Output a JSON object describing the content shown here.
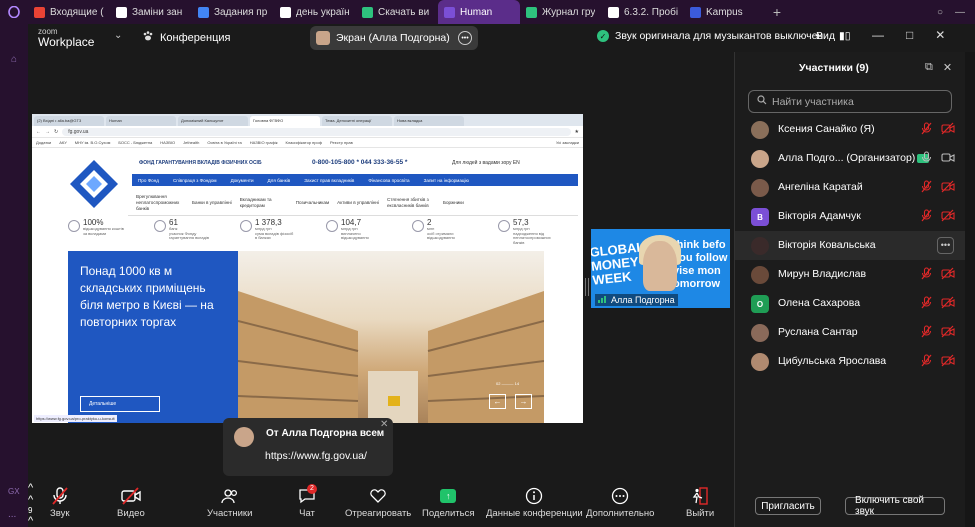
{
  "tabstrip": {
    "tabs": [
      {
        "label": "Входящие (",
        "color": "#ea4335"
      },
      {
        "label": "Заміни зан",
        "color": "#ffffff"
      },
      {
        "label": "Задания пр",
        "color": "#4285f4"
      },
      {
        "label": "день україн",
        "color": "#ffffff"
      },
      {
        "label": "Скачать ви",
        "color": "#2ec27e"
      },
      {
        "label": "Human",
        "color": "#7b4fd6",
        "active": true
      },
      {
        "label": "Журнал гру",
        "color": "#2ec27e"
      },
      {
        "label": "6.3.2. Пробі",
        "color": "#ffffff"
      },
      {
        "label": "Kampus",
        "color": "#3b5bdb"
      }
    ]
  },
  "os_sidebar": {
    "bottom_label": "GX",
    "dots": "..."
  },
  "zoom": {
    "logo_top": "zoom",
    "logo_bottom": "Workplace",
    "meeting_label": "Конференция",
    "screen_pill": "Экран (Алла Подгорна)",
    "audio_note": "Звук оригинала для музыкантов выключен",
    "view_label": "Вид"
  },
  "shared_screen": {
    "browser_tabs": [
      "(2) Вхідні • alla.ba@GT3",
      "Human",
      "Допоміжний Калькулят",
      "Головна ФГВФО",
      "Тема. Депозитні операції",
      "Нова вкладка"
    ],
    "url": "fg.gov.ua",
    "bookmarks": [
      "Додатки",
      "АКУ",
      "МНУ ім. В.О.Сухом",
      "БОСС - Бюджетна",
      "НАЗВІО",
      "Jethealth",
      "Освіта в Україні та",
      "НАЗВІО графік",
      "Класифікатор проф",
      "Реєстр прав"
    ],
    "bookmarks_right": "Усі закладки",
    "site_title": "ФОНД ГАРАНТУВАННЯ ВКЛАДІВ ФІЗИЧНИХ ОСІБ",
    "phones": "0-800-105-800 *   044 333-36-55 *",
    "accessibility": "Для людей з вадами зору   EN",
    "nav": [
      "Про Фонд",
      "Співпраця з Фондом",
      "Документи",
      "Для банків",
      "Захист прав вкладників",
      "Фінансова просвіта",
      "Запит на інформацію"
    ],
    "menu": [
      "Врегулювання неплатоспроможних банків",
      "Банки в управлінні",
      "Вкладникам та кредиторам",
      "Позичальникам",
      "Активи в управлінні",
      "Стягнення збитків з ексвласників банків",
      "Боржники"
    ],
    "stats": [
      {
        "value": "100%",
        "label": "відшкодування коштів\nза вкладами"
      },
      {
        "value": "61",
        "label": "банк\nучасник Фонду\nгарантування вкладів"
      },
      {
        "value": "1 378,3",
        "label": "млрд грн\nсума вкладів фізосіб\nв банках"
      },
      {
        "value": "104,7",
        "label": "млрд грн\nвиплачено\nвідшкодування"
      },
      {
        "value": "2",
        "label": "млн\nосіб отримали\nвідшкодування"
      },
      {
        "value": "57,3",
        "label": "млрд грн\nнадходження від\nнеплатоспроможних\nбанків"
      }
    ],
    "hero_text": "Понад 1000 кв м складських приміщень біля метро в Києві — на повторних торгах",
    "hero_button": "Детальніше",
    "hero_pager": "02 ——— 14",
    "hero_prev": "←",
    "hero_next": "→",
    "status_url": "https://www.fg.gov.ua/pro-praktyku-u-konsult"
  },
  "video_thumb": {
    "left_text": "GLOBAL\nMONEY\nWEEK",
    "right_text": "think befo\nyou follow\nvise mon\nomorrow",
    "name": "Алла Подгорна"
  },
  "chat_popup": {
    "from": "От Алла Подгорна всем",
    "message": "https://www.fg.gov.ua/"
  },
  "participants": {
    "title": "Участники (9)",
    "search_placeholder": "Найти участника",
    "items": [
      {
        "name": "Ксения Санайко (Я)",
        "avatar": "photo",
        "color": "#8a6f5a",
        "mic": "muted",
        "cam": "off"
      },
      {
        "name": "Алла Подго... (Организатор)",
        "avatar": "photo",
        "color": "#c9a58a",
        "mic": "on",
        "cam": "on"
      },
      {
        "name": "Ангеліна Каратай",
        "avatar": "photo",
        "color": "#7a5a4a",
        "mic": "muted",
        "cam": "off"
      },
      {
        "name": "Вікторія Адамчук",
        "avatar": "В",
        "color": "#7b4fd6",
        "mic": "muted",
        "cam": "off"
      },
      {
        "name": "Вікторія Ковальська",
        "avatar": "photo",
        "color": "#3a2a2a",
        "more": true
      },
      {
        "name": "Мирун Владислав",
        "avatar": "photo",
        "color": "#6a4a3a",
        "mic": "muted",
        "cam": "off"
      },
      {
        "name": "Олена Сахарова",
        "avatar": "О",
        "color": "#1f9d55",
        "mic": "muted",
        "cam": "off"
      },
      {
        "name": "Руслана Сантар",
        "avatar": "photo",
        "color": "#8a6a5a",
        "mic": "muted",
        "cam": "off"
      },
      {
        "name": "Цибульська Ярослава",
        "avatar": "photo",
        "color": "#b08a70",
        "mic": "muted",
        "cam": "off"
      }
    ],
    "invite_label": "Пригласить",
    "unmute_label": "Включить свой звук"
  },
  "toolbar": {
    "audio": "Звук",
    "video": "Видео",
    "participants": "Участники",
    "participants_count": "9",
    "chat": "Чат",
    "chat_badge": "2",
    "react": "Отреагировать",
    "share": "Поделиться",
    "meeting_data": "Данные конференции",
    "more": "Дополнительно",
    "leave": "Выйти"
  }
}
